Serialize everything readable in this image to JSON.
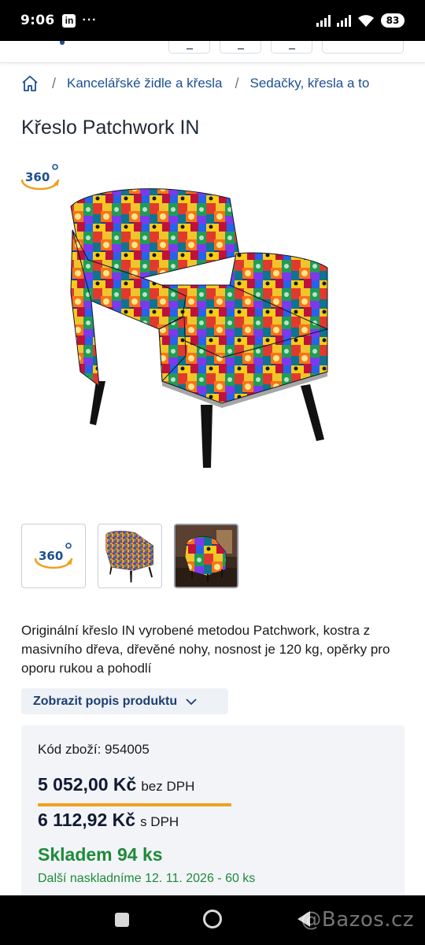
{
  "status_bar": {
    "time": "9:06",
    "app_badge": "in",
    "more": "···",
    "battery": "83"
  },
  "breadcrumb": {
    "items": [
      {
        "label": "Kancelářské židle a křesla"
      },
      {
        "label": "Sedačky, křesla a to"
      }
    ],
    "separator": "/"
  },
  "product": {
    "title": "Křeslo Patchwork IN",
    "badge_360": "360",
    "description": "Originální křeslo IN vyrobené metodou Patchwork, kostra z masivního dřeva, dřevěné nohy, nosnost je 120 kg, opěrky pro oporu rukou a pohodlí",
    "show_description_label": "Zobrazit popis produktu"
  },
  "thumbnails": [
    {
      "name": "360-view",
      "label": "360"
    },
    {
      "name": "chair-photo"
    },
    {
      "name": "chair-room-photo"
    }
  ],
  "pricing": {
    "code_label": "Kód zboží: 954005",
    "price_ex_vat": "5 052,00 Kč",
    "price_ex_vat_suffix": "bez DPH",
    "price_inc_vat": "6 112,92 Kč",
    "price_inc_vat_suffix": "s DPH",
    "stock": "Skladem 94 ks",
    "restock": "Další naskladníme 12. 11. 2026 - 60 ks"
  },
  "nav_bar": {
    "watermark": "@Bazos.cz"
  },
  "colors": {
    "brand_blue": "#1d4f91",
    "price_underline": "#f0a01e",
    "stock_green": "#1f8a3a",
    "badge_orange": "#f0a01e"
  },
  "icons": [
    "linkedin-icon",
    "signal-icon",
    "wifi-icon",
    "home-icon",
    "chevron-down-icon",
    "360-icon"
  ]
}
